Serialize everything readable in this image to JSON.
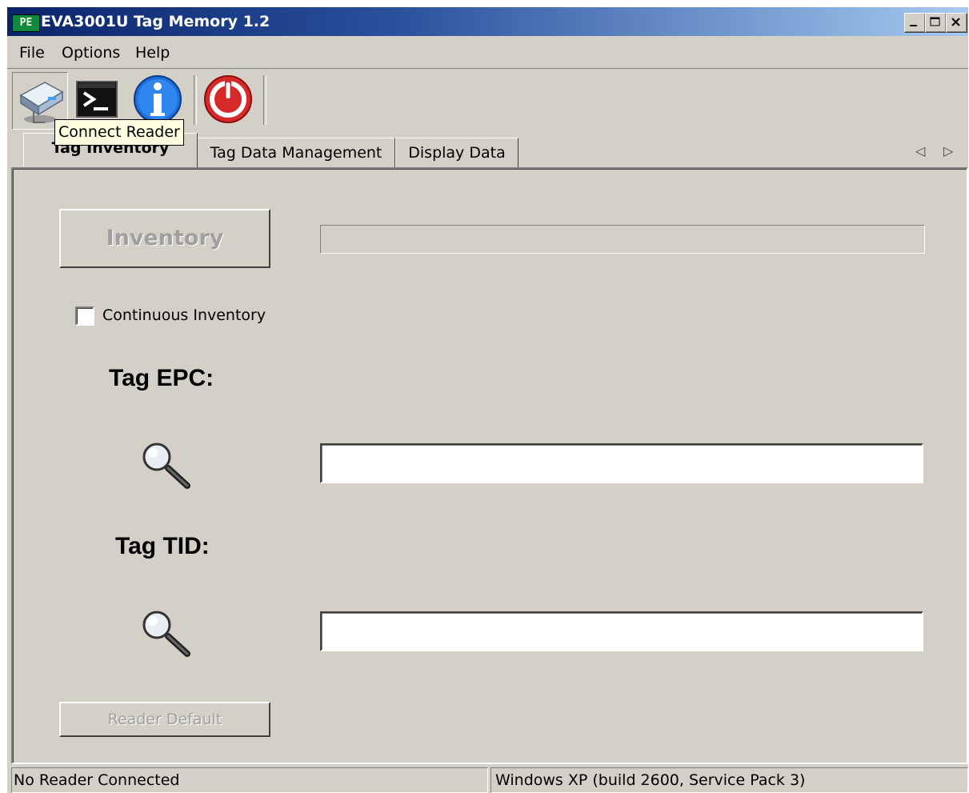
{
  "window": {
    "title": "EVA3001U Tag Memory 1.2",
    "app_icon": "PE"
  },
  "title_buttons": {
    "minimize": "minimize-icon",
    "maximize": "maximize-icon",
    "close": "close-icon"
  },
  "menu": {
    "file": "File",
    "options": "Options",
    "help": "Help"
  },
  "toolbar": {
    "connect": "connect-reader-icon",
    "console": "console-icon",
    "info": "info-icon",
    "power": "power-icon",
    "tooltip": "Connect Reader"
  },
  "tabs": [
    "Tag Inventory",
    "Tag Data Management",
    "Display Data"
  ],
  "inventory": {
    "button": "Inventory",
    "continuous_label": "Continuous Inventory",
    "continuous_checked": false,
    "epc_label": "Tag EPC:",
    "tid_label": "Tag TID:",
    "epc_value": "",
    "tid_value": "",
    "reader_default_button": "Reader Default"
  },
  "status": {
    "left": "No Reader Connected",
    "right": "Windows XP (build 2600, Service Pack 3)"
  },
  "colors": {
    "titlebar_start": "#0a246a",
    "titlebar_end": "#a6caf0",
    "face": "#d4d0c8",
    "tooltip_bg": "#ffffe1"
  }
}
